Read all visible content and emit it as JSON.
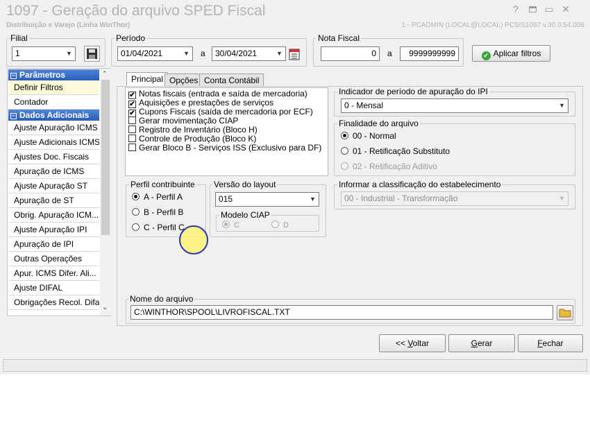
{
  "window": {
    "title": "1097 - Geração do arquivo SPED Fiscal",
    "subtitle": "Distribuição e Varejo (Linha WinThor)",
    "status_info": "1 - PCADMIN (LOCAL@LOCAL)   PCSIS1097  v.30.0.54.006",
    "help_glyph": "?",
    "minimize_glyph": "▭",
    "close_glyph": "✕"
  },
  "filial": {
    "label": "Filial",
    "value": "1"
  },
  "periodo": {
    "label": "Período",
    "start": "01/04/2021",
    "sep": "a",
    "end": "30/04/2021"
  },
  "nota_fiscal": {
    "label": "Nota Fiscal",
    "from": "0",
    "sep": "a",
    "to": "9999999999"
  },
  "apply_filters_label": "Aplicar filtros",
  "sidebar": {
    "sections": [
      {
        "title": "Parâmetros",
        "items": [
          "Definir Filtros",
          "Contador"
        ]
      },
      {
        "title": "Dados Adicionais",
        "items": [
          "Ajuste Apuração ICMS",
          "Ajuste Adicionais ICMS",
          "Ajustes Doc. Fiscais",
          "Apuração de ICMS",
          "Ajuste Apuração ST",
          "Apuração de ST",
          "Obrig. Apuração ICM...",
          "Ajuste Apuração IPI",
          "Apuração de IPI",
          "Outras Operações",
          "Apur. ICMS Difer. Ali...",
          "Ajuste DIFAL",
          "Obrigações Recol. Difal"
        ]
      }
    ]
  },
  "tabs": [
    "Principal",
    "Opções",
    "Conta Contábil"
  ],
  "checklist": [
    {
      "label": "Notas fiscais (entrada e saída de mercadoria)",
      "checked": true
    },
    {
      "label": "Aquisições e prestações de serviços",
      "checked": true
    },
    {
      "label": "Cupons Fiscais (saída de mercadoria por ECF)",
      "checked": true
    },
    {
      "label": "Gerar movimentação CIAP",
      "checked": false
    },
    {
      "label": "Registro de Inventário (Bloco H)",
      "checked": false
    },
    {
      "label": "Controle de Produção (Bloco K)",
      "checked": false
    },
    {
      "label": "Gerar Bloco B - Serviços ISS (Exclusivo para DF)",
      "checked": false
    }
  ],
  "check_glyph": "✔",
  "ipi_period": {
    "label": "Indicador de período de apuração do IPI",
    "value": "0 - Mensal"
  },
  "finalidade": {
    "label": "Finalidade do arquivo",
    "options": [
      "00 - Normal",
      "01 - Retificação Substituto",
      "02 - Retificação Aditivo"
    ]
  },
  "perfil": {
    "label": "Perfil contribuinte",
    "options": [
      "A - Perfil A",
      "B - Perfil B",
      "C - Perfil C"
    ]
  },
  "versao": {
    "label": "Versão do layout",
    "value": "015"
  },
  "modelo_ciap": {
    "label": "Modelo CIAP",
    "options": [
      "C",
      "D"
    ]
  },
  "classificacao": {
    "label": "Informar a classificação do estabelecimento",
    "value": "00 - Industrial - Transformação"
  },
  "arquivo": {
    "label": "Nome do arquivo",
    "value": "C:\\WINTHOR\\SPOOL\\LIVROFISCAL.TXT"
  },
  "buttons": {
    "voltar_prefix": "<< ",
    "voltar_hot": "V",
    "voltar_rest": "oltar",
    "gerar_hot": "G",
    "gerar_rest": "erar",
    "fechar_hot": "F",
    "fechar_rest": "echar"
  },
  "colors": {
    "sidebar_header": "#2a5db8",
    "cursor_highlight": "#fff36a",
    "cursor_ring": "#2b33b5"
  }
}
